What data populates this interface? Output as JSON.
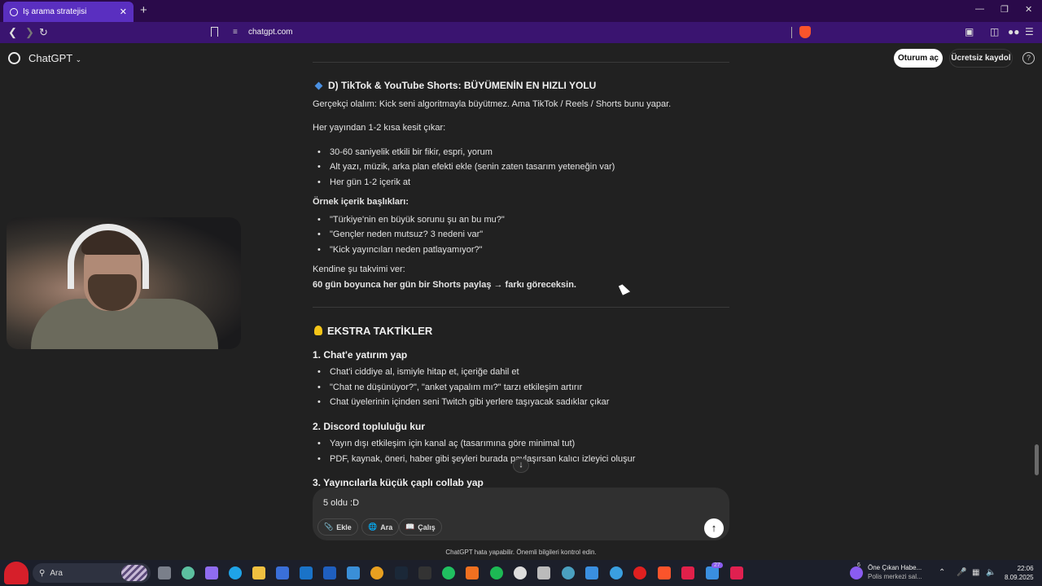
{
  "browser": {
    "tab_title": "İş arama stratejisi",
    "tab_close": "✕",
    "new_tab": "+",
    "url": "chatgpt.com",
    "controls": {
      "minimize": "—",
      "restore": "❐",
      "close": "✕"
    }
  },
  "header": {
    "app_name": "ChatGPT",
    "login_label": "Oturum aç",
    "signup_label": "Ücretsiz kaydol",
    "help": "?"
  },
  "content": {
    "section_d_title": "D) TikTok & YouTube Shorts: BÜYÜMENİN EN HIZLI YOLU",
    "section_d_intro": "Gerçekçi olalım: Kick seni algoritmayla büyütmez. Ama TikTok / Reels / Shorts bunu yapar.",
    "clip_instruction": "Her yayından 1-2 kısa kesit çıkar:",
    "clip_bullets": [
      "30-60 saniyelik etkili bir fikir, espri, yorum",
      "Alt yazı, müzik, arka plan efekti ekle (senin zaten tasarım yeteneğin var)",
      "Her gün 1-2 içerik at"
    ],
    "examples_title": "Örnek içerik başlıkları:",
    "example_bullets": [
      "\"Türkiye'nin en büyük sorunu şu an bu mu?\"",
      "\"Gençler neden mutsuz? 3 nedeni var\"",
      "\"Kick yayıncıları neden patlayamıyor?\""
    ],
    "calendar_intro": "Kendine şu takvimi ver:",
    "calendar_bold": "60 gün boyunca her gün bir Shorts paylaş → farkı göreceksin.",
    "extra_title": "EKSTRA TAKTİKLER",
    "sub1_title": "1. Chat'e yatırım yap",
    "sub1_bullets": [
      "Chat'i ciddiye al, ismiyle hitap et, içeriğe dahil et",
      "\"Chat ne düşünüyor?\", \"anket yapalım mı?\" tarzı etkileşim artırır",
      "Chat üyelerinin içinden seni Twitch gibi yerlere taşıyacak sadıklar çıkar"
    ],
    "sub2_title": "2. Discord topluluğu kur",
    "sub2_bullets": [
      "Yayın dışı etkileşim için kanal aç (tasarımına göre minimal tut)",
      "PDF, kaynak, öneri, haber gibi şeyleri burada paylaşırsan kalıcı izleyici oluşur"
    ],
    "sub3_title": "3. Yayıncılarla küçük çaplı collab yap"
  },
  "composer": {
    "text": "5 oldu :D",
    "attach_label": "Ekle",
    "search_label": "Ara",
    "study_label": "Çalış",
    "send": "↑"
  },
  "scroll_down": "↓",
  "footer_note": "ChatGPT hata yapabilir. Önemli bilgileri kontrol edin.",
  "taskbar": {
    "search_placeholder": "Ara",
    "news_title": "Öne Çıkan Habe...",
    "news_sub": "Polis merkezi sal...",
    "news_badge": "6",
    "app_badge": "27",
    "time": "22:06",
    "date": "8.09.2025"
  },
  "colors": {
    "title_bar": "#2a0a4a",
    "tab_active": "#5a2fc0",
    "address_bar": "#3a1470",
    "page_bg": "#212121",
    "composer_bg": "#303030",
    "taskbar_bg": "#1c1f2a"
  }
}
